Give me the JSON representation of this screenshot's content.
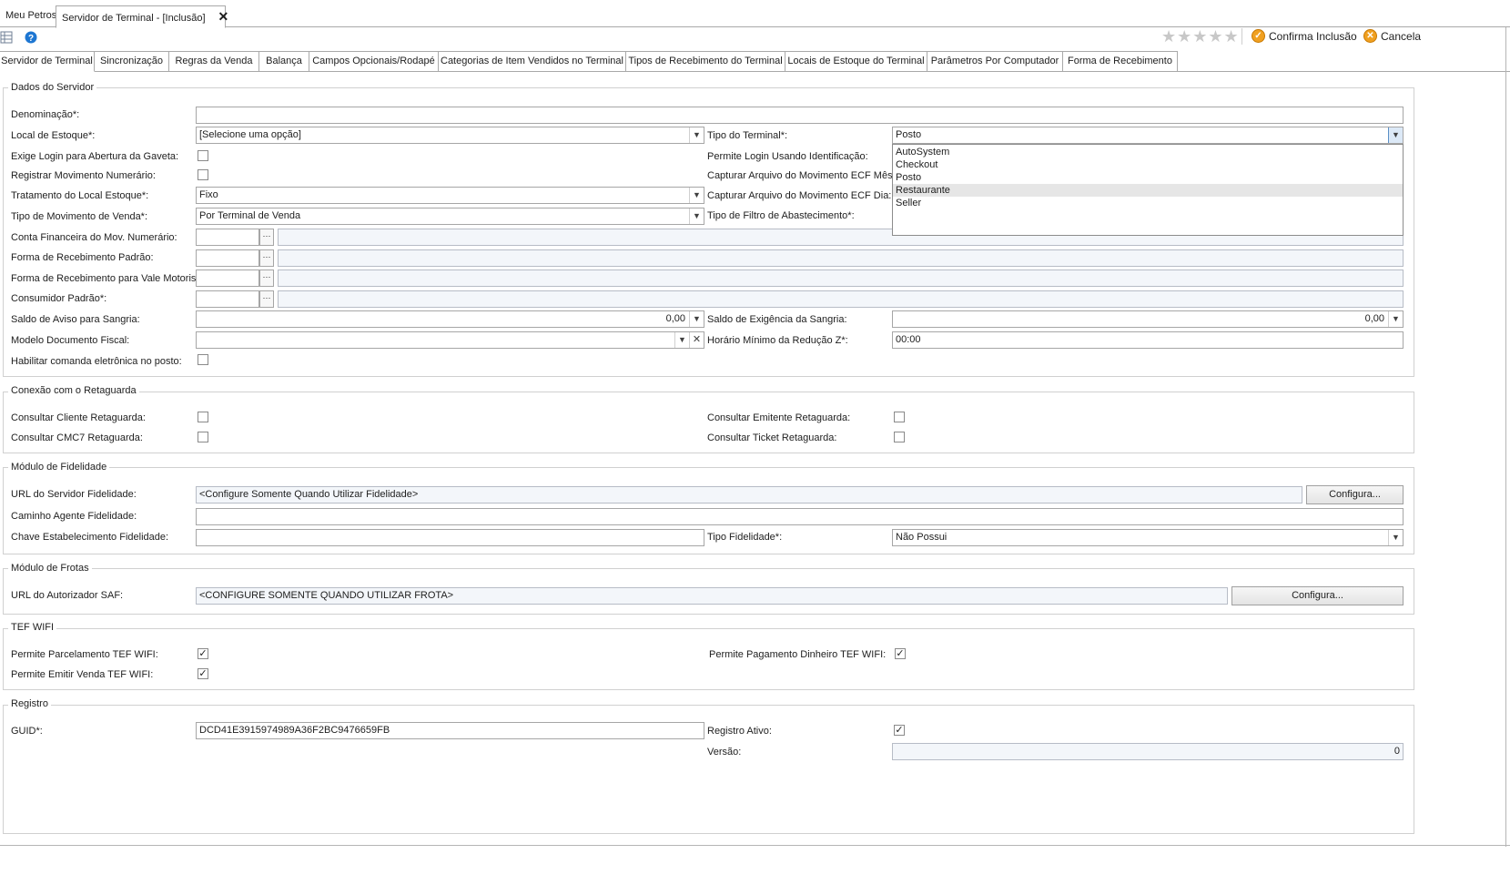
{
  "doc_tabs": [
    {
      "label": "Meu Petros"
    },
    {
      "label": "Servidor de Terminal - [Inclusão]"
    }
  ],
  "toolbar": {
    "stars": "★★★★★",
    "confirm_label": "Confirma Inclusão",
    "cancel_label": "Cancela"
  },
  "page_tabs": [
    {
      "label": "Servidor de Terminal"
    },
    {
      "label": "Sincronização"
    },
    {
      "label": "Regras da Venda"
    },
    {
      "label": "Balança"
    },
    {
      "label": "Campos Opcionais/Rodapé"
    },
    {
      "label": "Categorias de Item Vendidos no Terminal"
    },
    {
      "label": "Tipos de Recebimento do Terminal"
    },
    {
      "label": "Locais de Estoque do Terminal"
    },
    {
      "label": "Parâmetros Por Computador"
    },
    {
      "label": "Forma de Recebimento"
    }
  ],
  "servidor": {
    "title": "Dados do Servidor",
    "denominacao_label": "Denominação*:",
    "denominacao_value": "",
    "local_estoque_label": "Local de Estoque*:",
    "local_estoque_value": "[Selecione uma opção]",
    "tipo_terminal_label": "Tipo do Terminal*:",
    "tipo_terminal_value": "Posto",
    "tipo_terminal_options": [
      "AutoSystem",
      "Checkout",
      "Posto",
      "Restaurante",
      "Seller"
    ],
    "exige_login_label": "Exige Login para Abertura da Gaveta:",
    "permite_login_label": "Permite Login Usando Identificação:",
    "registrar_mov_label": "Registrar Movimento Numerário:",
    "capturar_mes_label": "Capturar Arquivo do Movimento ECF Mês:",
    "tratamento_label": "Tratamento do Local Estoque*:",
    "tratamento_value": "Fixo",
    "capturar_dia_label": "Capturar Arquivo do Movimento ECF Dia:",
    "tipo_mov_label": "Tipo de Movimento de Venda*:",
    "tipo_mov_value": "Por Terminal de Venda",
    "tipo_filtro_label": "Tipo de Filtro de Abastecimento*:",
    "conta_fin_label": "Conta Financeira do Mov. Numerário:",
    "forma_padrao_label": "Forma de Recebimento Padrão:",
    "forma_vale_label": "Forma de Recebimento para Vale Motorista:",
    "consumidor_label": "Consumidor Padrão*:",
    "saldo_aviso_label": "Saldo de Aviso para Sangria:",
    "saldo_aviso_value": "0,00",
    "saldo_exig_label": "Saldo de Exigência da Sangria:",
    "saldo_exig_value": "0,00",
    "modelo_doc_label": "Modelo Documento Fiscal:",
    "horario_label": "Horário Mínimo da Redução Z*:",
    "horario_value": "00:00",
    "habilitar_label": "Habilitar comanda eletrônica no posto:",
    "ellipsis": "···"
  },
  "conexao": {
    "title": "Conexão com o Retaguarda",
    "cliente_label": "Consultar Cliente Retaguarda:",
    "emitente_label": "Consultar Emitente Retaguarda:",
    "cmc7_label": "Consultar CMC7 Retaguarda:",
    "ticket_label": "Consultar Ticket Retaguarda:"
  },
  "fidelidade": {
    "title": "Módulo de Fidelidade",
    "url_label": "URL do Servidor Fidelidade:",
    "url_value": "<Configure Somente Quando Utilizar Fidelidade>",
    "configura_label": "Configura...",
    "caminho_label": "Caminho Agente Fidelidade:",
    "chave_label": "Chave Estabelecimento Fidelidade:",
    "tipo_label": "Tipo Fidelidade*:",
    "tipo_value": "Não Possui"
  },
  "frotas": {
    "title": "Módulo de Frotas",
    "url_label": "URL do Autorizador SAF:",
    "url_value": "<CONFIGURE SOMENTE QUANDO UTILIZAR FROTA>",
    "configura_label": "Configura..."
  },
  "tef": {
    "title": "TEF WIFI",
    "parcelamento_label": "Permite Parcelamento TEF WIFI:",
    "dinheiro_label": "Permite Pagamento Dinheiro TEF WIFI:",
    "emitir_label": "Permite Emitir Venda TEF WIFI:",
    "check": "✓"
  },
  "registro": {
    "title": "Registro",
    "guid_label": "GUID*:",
    "guid_value": "DCD41E3915974989A36F2BC9476659FB",
    "ativo_label": "Registro Ativo:",
    "versao_label": "Versão:",
    "versao_value": "0"
  }
}
